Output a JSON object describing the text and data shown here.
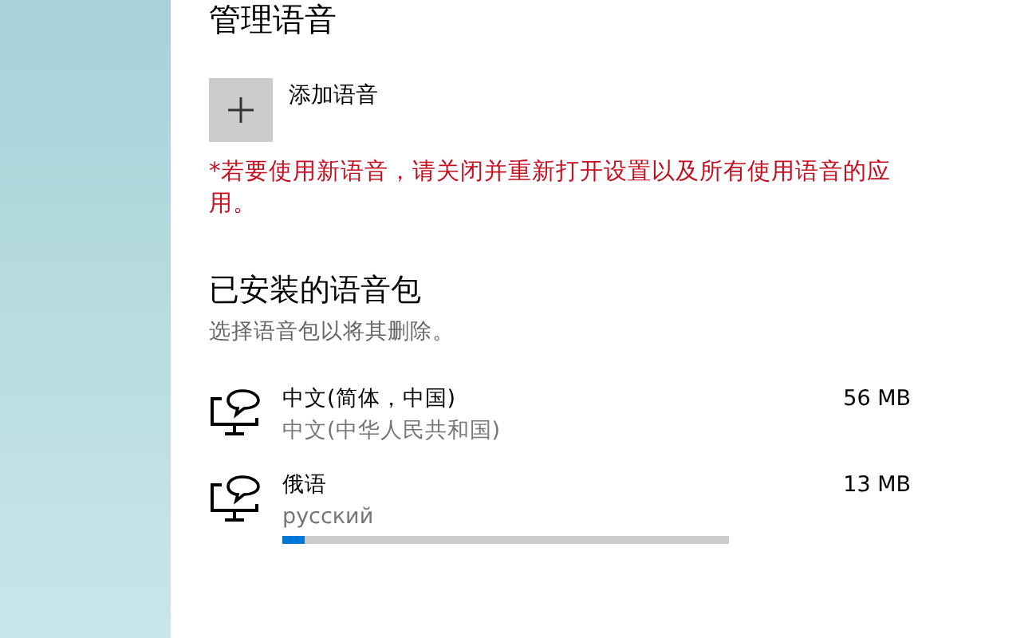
{
  "section_title": "管理语音",
  "add_language": {
    "label": "添加语音"
  },
  "restart_note": "*若要使用新语音，请关闭并重新打开设置以及所有使用语音的应用。",
  "installed": {
    "title": "已安装的语音包",
    "hint": "选择语音包以将其删除。",
    "packs": [
      {
        "name": "中文(简体，中国)",
        "native_name": "中文(中华人民共和国)",
        "size": "56 MB"
      },
      {
        "name": "俄语",
        "native_name": "русский",
        "size": "13 MB",
        "level": 0.05
      }
    ]
  }
}
